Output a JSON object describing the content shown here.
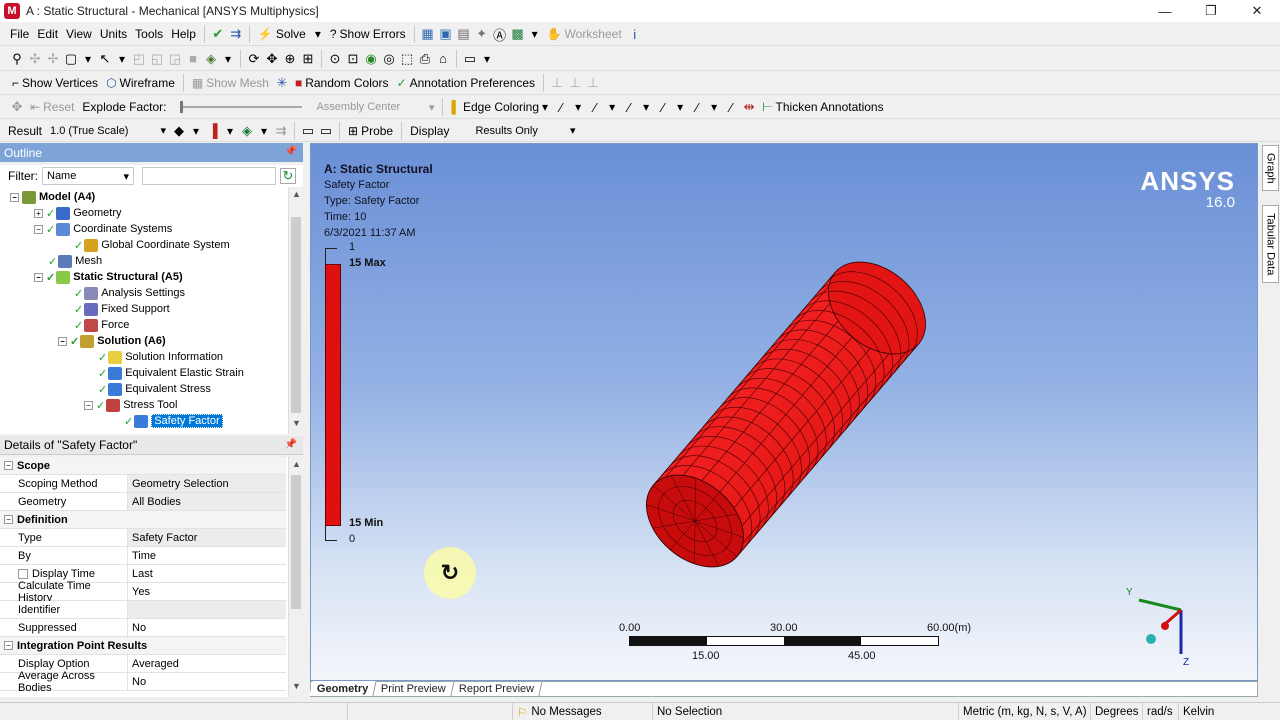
{
  "window": {
    "title": "A : Static Structural - Mechanical [ANSYS Multiphysics]",
    "logo": "M",
    "controls": [
      "—",
      "❐",
      "✕"
    ]
  },
  "menu": {
    "items": [
      "File",
      "Edit",
      "View",
      "Units",
      "Tools",
      "Help"
    ],
    "solve": "Solve",
    "show_errors": "Show Errors",
    "worksheet": "Worksheet"
  },
  "toolbar3": {
    "show_vertices": "Show Vertices",
    "wireframe": "Wireframe",
    "show_mesh": "Show Mesh",
    "random_colors": "Random Colors",
    "annotation_preferences": "Annotation Preferences"
  },
  "toolbar4": {
    "reset": "Reset",
    "explode_factor": "Explode Factor:",
    "assembly_center": "Assembly Center",
    "edge_coloring": "Edge Coloring",
    "thicken_annotations": "Thicken Annotations"
  },
  "toolbar5": {
    "result_label": "Result",
    "result_value": "1.0 (True Scale)",
    "probe": "Probe",
    "display_label": "Display",
    "display_value": "Results Only"
  },
  "outline": {
    "title": "Outline",
    "filter_label": "Filter:",
    "filter_value": "Name",
    "tree": [
      {
        "label": "Model (A4)",
        "bold": true
      },
      {
        "label": "Geometry"
      },
      {
        "label": "Coordinate Systems"
      },
      {
        "label": "Global Coordinate System"
      },
      {
        "label": "Mesh"
      },
      {
        "label": "Static Structural (A5)",
        "bold": true
      },
      {
        "label": "Analysis Settings"
      },
      {
        "label": "Fixed Support"
      },
      {
        "label": "Force"
      },
      {
        "label": "Solution (A6)",
        "bold": true
      },
      {
        "label": "Solution Information"
      },
      {
        "label": "Equivalent Elastic Strain"
      },
      {
        "label": "Equivalent Stress"
      },
      {
        "label": "Stress Tool"
      },
      {
        "label": "Safety Factor",
        "selected": true
      }
    ]
  },
  "details": {
    "title": "Details of \"Safety Factor\"",
    "rows": [
      {
        "section": "Scope"
      },
      {
        "k": "Scoping Method",
        "v": "Geometry Selection",
        "gray": true
      },
      {
        "k": "Geometry",
        "v": "All Bodies",
        "gray": true
      },
      {
        "section": "Definition"
      },
      {
        "k": "Type",
        "v": "Safety Factor",
        "gray": true
      },
      {
        "k": "By",
        "v": "Time"
      },
      {
        "k": "Display Time",
        "v": "Last",
        "checkbox": true
      },
      {
        "k": "Calculate Time History",
        "v": "Yes"
      },
      {
        "k": "Identifier",
        "v": "",
        "gray": true
      },
      {
        "k": "Suppressed",
        "v": "No"
      },
      {
        "section": "Integration Point Results"
      },
      {
        "k": "Display Option",
        "v": "Averaged"
      },
      {
        "k": "Average Across Bodies",
        "v": "No"
      }
    ]
  },
  "viewport": {
    "info_title": "A: Static Structural",
    "info_lines": [
      "Safety Factor",
      "Type: Safety Factor",
      "Time: 10",
      "6/3/2021 11:37 AM"
    ],
    "brand": "ANSYS",
    "version": "16.0",
    "legend": {
      "top_tick": "1",
      "max_label": "15 Max",
      "min_label": "15 Min",
      "bottom_tick": "0",
      "color": "#e01010"
    },
    "scale": {
      "top_labels": [
        "0.00",
        "30.00",
        "60.00"
      ],
      "unit": "(m)",
      "bottom_labels": [
        "15.00",
        "45.00"
      ]
    },
    "triad": {
      "y": "Y",
      "z": "Z"
    },
    "model_color": "#e21414"
  },
  "tabs": [
    "Geometry",
    "Print Preview",
    "Report Preview"
  ],
  "side_tabs": [
    "Graph",
    "Tabular Data"
  ],
  "status": {
    "messages": "No Messages",
    "selection": "No Selection",
    "units": "Metric (m, kg, N, s, V, A)",
    "angle": "Degrees",
    "rot": "rad/s",
    "temp": "Kelvin"
  }
}
